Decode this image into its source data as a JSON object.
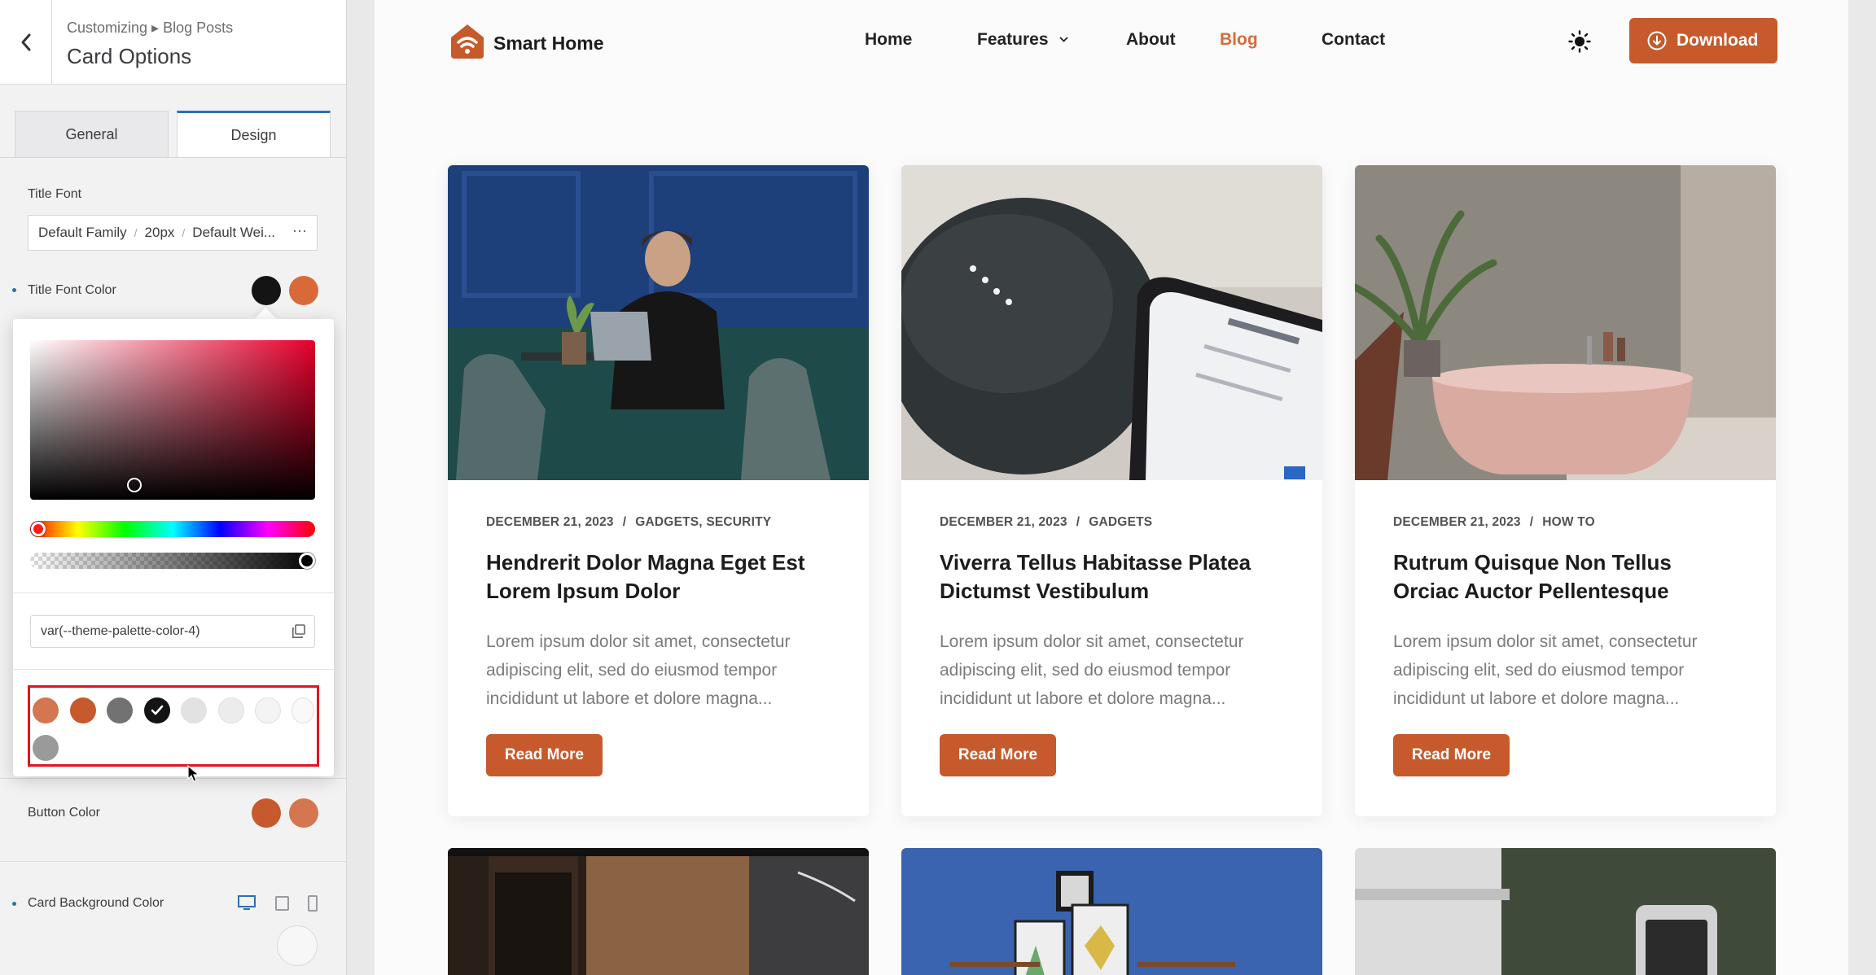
{
  "sidebar": {
    "breadcrumb": "Customizing ▸ Blog Posts",
    "title": "Card Options",
    "tabs": [
      {
        "label": "General"
      },
      {
        "label": "Design"
      }
    ],
    "title_font": {
      "label": "Title Font",
      "family": "Default Family",
      "size": "20px",
      "weight": "Default Wei..."
    },
    "title_font_color": {
      "label": "Title Font Color",
      "colors": [
        "#141414",
        "#d86a3a"
      ]
    },
    "color_picker": {
      "value": "var(--theme-palette-color-4)",
      "palette": [
        "#d4764f",
        "#c65a2c",
        "#727272",
        "#141414",
        "#e2e2e2",
        "#ececec",
        "#f4f4f4",
        "#f9f9f9",
        "#9a9a9a"
      ],
      "selected_index": 3
    },
    "button_color": {
      "label": "Button Color",
      "colors": [
        "#c65a2c",
        "#d4764f"
      ]
    },
    "card_background_color": {
      "label": "Card Background Color"
    }
  },
  "site": {
    "brand": "Smart Home",
    "nav": [
      {
        "label": "Home"
      },
      {
        "label": "Features"
      },
      {
        "label": "About"
      },
      {
        "label": "Blog"
      },
      {
        "label": "Contact"
      }
    ],
    "download_label": "Download",
    "accent": "#c65a2c",
    "cards": [
      {
        "date": "DECEMBER 21, 2023",
        "category": "GADGETS, SECURITY",
        "title": "Hendrerit Dolor Magna Eget Est Lorem Ipsum Dolor",
        "excerpt": "Lorem ipsum dolor sit amet, consectetur adipiscing elit, sed do eiusmod tempor incididunt ut labore et dolore magna...",
        "button": "Read More"
      },
      {
        "date": "DECEMBER 21, 2023",
        "category": "GADGETS",
        "title": "Viverra Tellus Habitasse Platea Dictumst Vestibulum",
        "excerpt": "Lorem ipsum dolor sit amet, consectetur adipiscing elit, sed do eiusmod tempor incididunt ut labore et dolore magna...",
        "button": "Read More"
      },
      {
        "date": "DECEMBER 21, 2023",
        "category": "HOW TO",
        "title": "Rutrum Quisque Non Tellus Orciac Auctor Pellentesque",
        "excerpt": "Lorem ipsum dolor sit amet, consectetur adipiscing elit, sed do eiusmod tempor incididunt ut labore et dolore magna...",
        "button": "Read More"
      }
    ]
  }
}
